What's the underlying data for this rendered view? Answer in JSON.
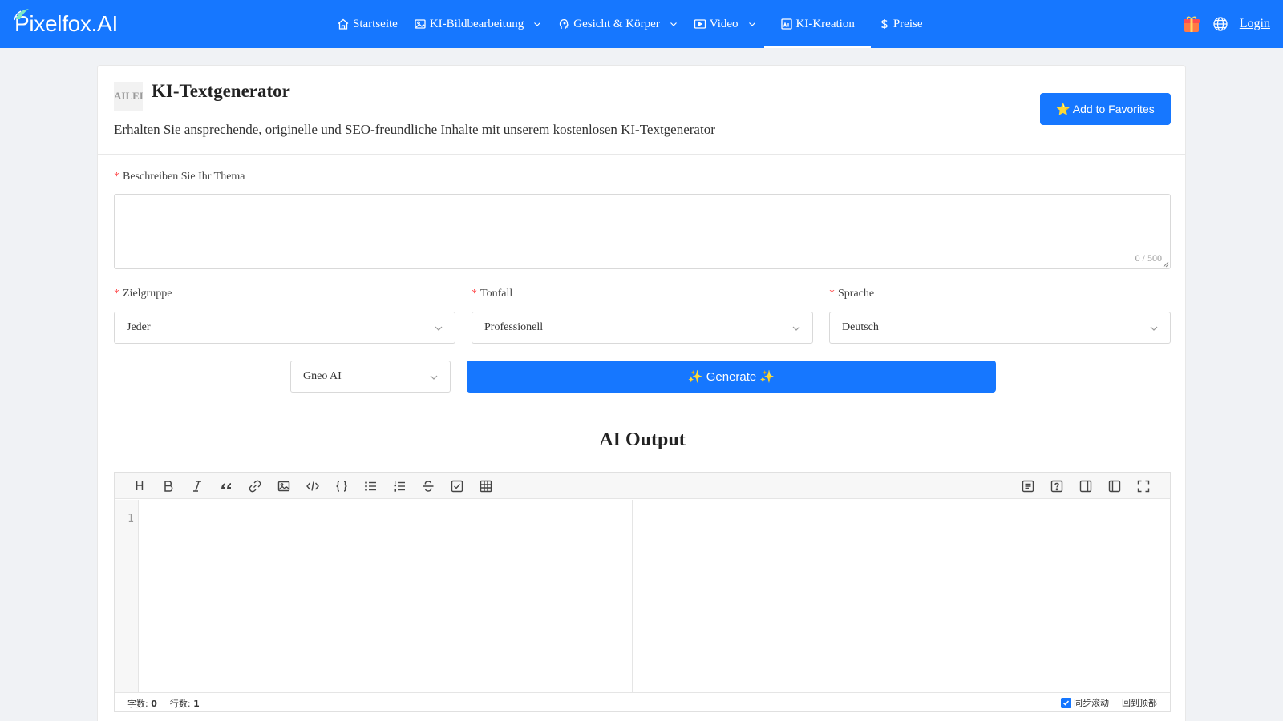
{
  "brand": {
    "logo_text": "Pixelfox.AI"
  },
  "nav": {
    "items": [
      {
        "label": "Startseite",
        "icon": "home-icon"
      },
      {
        "label": "KI-Bildbearbeitung",
        "icon": "image-icon",
        "dropdown": true
      },
      {
        "label": "Gesicht & Körper",
        "icon": "face-icon",
        "dropdown": true
      },
      {
        "label": "Video",
        "icon": "video-icon",
        "dropdown": true
      },
      {
        "label": "KI-Kreation",
        "icon": "ai-creation-icon",
        "active": true
      },
      {
        "label": "Preise",
        "icon": "dollar-icon"
      }
    ],
    "login": "Login"
  },
  "tool": {
    "icon_text": "AILEI",
    "title": "KI-Textgenerator",
    "subtitle": "Erhalten Sie ansprechende, originelle und SEO-freundliche Inhalte mit unserem kostenlosen KI-Textgenerator",
    "favorites_button": "⭐ Add to Favorites"
  },
  "form": {
    "topic": {
      "label": "Beschreiben Sie Ihr Thema",
      "value": "",
      "counter": "0 / 500"
    },
    "audience": {
      "label": "Zielgruppe",
      "value": "Jeder"
    },
    "tone": {
      "label": "Tonfall",
      "value": "Professionell"
    },
    "language": {
      "label": "Sprache",
      "value": "Deutsch"
    },
    "model": {
      "value": "Gneo AI"
    },
    "generate_button": "✨ Generate ✨"
  },
  "output": {
    "title": "AI Output",
    "line_number": "1",
    "status": {
      "chars_label": "字数:",
      "chars_value": "0",
      "lines_label": "行数:",
      "lines_value": "1",
      "sync_scroll": "同步滚动",
      "back_to_top": "回到顶部"
    }
  },
  "colors": {
    "primary": "#1677ff",
    "required": "#ff4d4f"
  }
}
